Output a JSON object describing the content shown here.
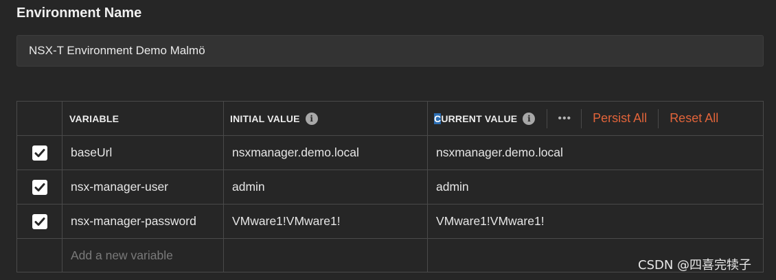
{
  "environment": {
    "label": "Environment Name",
    "name_value": "NSX-T Environment Demo Malmö"
  },
  "table": {
    "headers": {
      "variable": "VARIABLE",
      "initial_value": "INITIAL VALUE",
      "current_value_caret": "C",
      "current_value_rest": "URRENT VALUE"
    },
    "actions": {
      "more": "•••",
      "persist_all": "Persist All",
      "reset_all": "Reset All"
    },
    "rows": [
      {
        "checked": true,
        "variable": "baseUrl",
        "initial_value": "nsxmanager.demo.local",
        "current_value": "nsxmanager.demo.local"
      },
      {
        "checked": true,
        "variable": "nsx-manager-user",
        "initial_value": "admin",
        "current_value": "admin"
      },
      {
        "checked": true,
        "variable": "nsx-manager-password",
        "initial_value": "VMware1!VMware1!",
        "current_value": "VMware1!VMware1!"
      }
    ],
    "new_variable_placeholder": "Add a new variable"
  },
  "watermark": "CSDN @四喜完犊子",
  "colors": {
    "background": "#262626",
    "accent": "#e2643a",
    "border": "#4a4a4a",
    "selection": "#2d6fb4"
  }
}
